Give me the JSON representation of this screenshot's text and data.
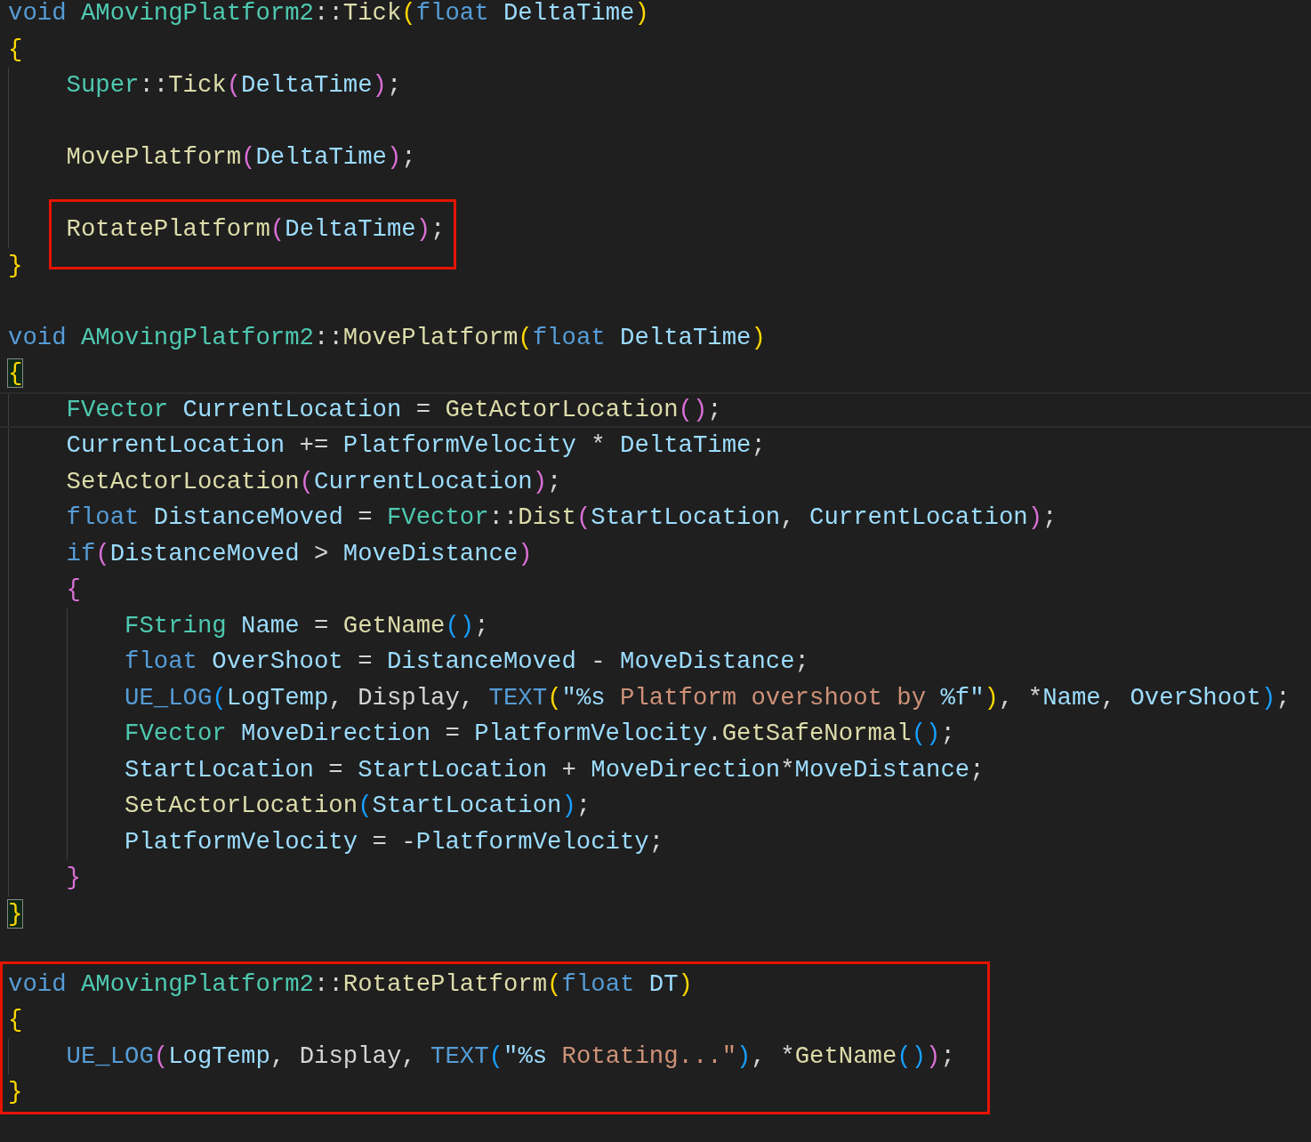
{
  "editor": {
    "lines": [
      {
        "kind": "code",
        "tokens": [
          {
            "text": "void ",
            "kind": "kw"
          },
          {
            "text": "AMovingPlatform2",
            "kind": "type"
          },
          {
            "text": "::",
            "kind": "op"
          },
          {
            "text": "Tick",
            "kind": "fn"
          },
          {
            "text": "(",
            "kind": "b1"
          },
          {
            "text": "float ",
            "kind": "kw"
          },
          {
            "text": "DeltaTime",
            "kind": "var"
          },
          {
            "text": ")",
            "kind": "b1"
          }
        ]
      },
      {
        "kind": "code",
        "tokens": [
          {
            "text": "{",
            "kind": "b1"
          }
        ]
      },
      {
        "kind": "code",
        "tokens": [
          {
            "text": "    Super",
            "kind": "type"
          },
          {
            "text": "::",
            "kind": "op"
          },
          {
            "text": "Tick",
            "kind": "fn"
          },
          {
            "text": "(",
            "kind": "b2"
          },
          {
            "text": "DeltaTime",
            "kind": "var"
          },
          {
            "text": ")",
            "kind": "b2"
          },
          {
            "text": ";",
            "kind": "op"
          }
        ]
      },
      {
        "kind": "blank"
      },
      {
        "kind": "code",
        "tokens": [
          {
            "text": "    MovePlatform",
            "kind": "fn"
          },
          {
            "text": "(",
            "kind": "b2"
          },
          {
            "text": "DeltaTime",
            "kind": "var"
          },
          {
            "text": ")",
            "kind": "b2"
          },
          {
            "text": ";",
            "kind": "op"
          }
        ]
      },
      {
        "kind": "blank"
      },
      {
        "kind": "code",
        "boxed": true,
        "tokens": [
          {
            "text": "    RotatePlatform",
            "kind": "fn"
          },
          {
            "text": "(",
            "kind": "b2"
          },
          {
            "text": "DeltaTime",
            "kind": "var"
          },
          {
            "text": ")",
            "kind": "b2"
          },
          {
            "text": ";",
            "kind": "op"
          }
        ]
      },
      {
        "kind": "code",
        "tokens": [
          {
            "text": "}",
            "kind": "b1"
          }
        ]
      },
      {
        "kind": "blank"
      },
      {
        "kind": "code",
        "tokens": [
          {
            "text": "void ",
            "kind": "kw"
          },
          {
            "text": "AMovingPlatform2",
            "kind": "type"
          },
          {
            "text": "::",
            "kind": "op"
          },
          {
            "text": "MovePlatform",
            "kind": "fn"
          },
          {
            "text": "(",
            "kind": "b1"
          },
          {
            "text": "float ",
            "kind": "kw"
          },
          {
            "text": "DeltaTime",
            "kind": "var"
          },
          {
            "text": ")",
            "kind": "b1"
          }
        ]
      },
      {
        "kind": "code",
        "tokens": [
          {
            "text": "{",
            "kind": "b1",
            "matched": true
          }
        ]
      },
      {
        "kind": "code",
        "current": true,
        "tokens": [
          {
            "text": "    FVector ",
            "kind": "type"
          },
          {
            "text": "CurrentLocation",
            "kind": "var"
          },
          {
            "text": " = ",
            "kind": "op"
          },
          {
            "text": "GetActorLocation",
            "kind": "fn"
          },
          {
            "text": "()",
            "kind": "b2"
          },
          {
            "text": ";",
            "kind": "op"
          }
        ]
      },
      {
        "kind": "code",
        "tokens": [
          {
            "text": "    CurrentLocation",
            "kind": "var"
          },
          {
            "text": " += ",
            "kind": "op"
          },
          {
            "text": "PlatformVelocity",
            "kind": "var"
          },
          {
            "text": " * ",
            "kind": "op"
          },
          {
            "text": "DeltaTime",
            "kind": "var"
          },
          {
            "text": ";",
            "kind": "op"
          }
        ]
      },
      {
        "kind": "code",
        "tokens": [
          {
            "text": "    SetActorLocation",
            "kind": "fn"
          },
          {
            "text": "(",
            "kind": "b2"
          },
          {
            "text": "CurrentLocation",
            "kind": "var"
          },
          {
            "text": ")",
            "kind": "b2"
          },
          {
            "text": ";",
            "kind": "op"
          }
        ]
      },
      {
        "kind": "code",
        "tokens": [
          {
            "text": "    float ",
            "kind": "kw"
          },
          {
            "text": "DistanceMoved",
            "kind": "var"
          },
          {
            "text": " = ",
            "kind": "op"
          },
          {
            "text": "FVector",
            "kind": "type"
          },
          {
            "text": "::",
            "kind": "op"
          },
          {
            "text": "Dist",
            "kind": "fn"
          },
          {
            "text": "(",
            "kind": "b2"
          },
          {
            "text": "StartLocation",
            "kind": "var"
          },
          {
            "text": ", ",
            "kind": "op"
          },
          {
            "text": "CurrentLocation",
            "kind": "var"
          },
          {
            "text": ")",
            "kind": "b2"
          },
          {
            "text": ";",
            "kind": "op"
          }
        ]
      },
      {
        "kind": "code",
        "tokens": [
          {
            "text": "    if",
            "kind": "kw"
          },
          {
            "text": "(",
            "kind": "b2"
          },
          {
            "text": "DistanceMoved",
            "kind": "var"
          },
          {
            "text": " > ",
            "kind": "op"
          },
          {
            "text": "MoveDistance",
            "kind": "var"
          },
          {
            "text": ")",
            "kind": "b2"
          }
        ]
      },
      {
        "kind": "code",
        "tokens": [
          {
            "text": "    {",
            "kind": "b2"
          }
        ]
      },
      {
        "kind": "code",
        "tokens": [
          {
            "text": "        FString ",
            "kind": "type"
          },
          {
            "text": "Name",
            "kind": "var"
          },
          {
            "text": " = ",
            "kind": "op"
          },
          {
            "text": "GetName",
            "kind": "fn"
          },
          {
            "text": "()",
            "kind": "b3"
          },
          {
            "text": ";",
            "kind": "op"
          }
        ]
      },
      {
        "kind": "code",
        "tokens": [
          {
            "text": "        float ",
            "kind": "kw"
          },
          {
            "text": "OverShoot",
            "kind": "var"
          },
          {
            "text": " = ",
            "kind": "op"
          },
          {
            "text": "DistanceMoved",
            "kind": "var"
          },
          {
            "text": " - ",
            "kind": "op"
          },
          {
            "text": "MoveDistance",
            "kind": "var"
          },
          {
            "text": ";",
            "kind": "op"
          }
        ]
      },
      {
        "kind": "code",
        "tokens": [
          {
            "text": "        UE_LOG",
            "kind": "kw"
          },
          {
            "text": "(",
            "kind": "b3"
          },
          {
            "text": "LogTemp",
            "kind": "var"
          },
          {
            "text": ", Display, ",
            "kind": "op"
          },
          {
            "text": "TEXT",
            "kind": "kw"
          },
          {
            "text": "(",
            "kind": "b1"
          },
          {
            "text": "\"%s",
            "kind": "fmt"
          },
          {
            "text": " Platform overshoot by ",
            "kind": "str"
          },
          {
            "text": "%f\"",
            "kind": "fmt"
          },
          {
            "text": ")",
            "kind": "b1"
          },
          {
            "text": ", *",
            "kind": "op"
          },
          {
            "text": "Name",
            "kind": "var"
          },
          {
            "text": ", ",
            "kind": "op"
          },
          {
            "text": "OverShoot",
            "kind": "var"
          },
          {
            "text": ")",
            "kind": "b3"
          },
          {
            "text": ";",
            "kind": "op"
          }
        ]
      },
      {
        "kind": "code",
        "tokens": [
          {
            "text": "        FVector ",
            "kind": "type"
          },
          {
            "text": "MoveDirection",
            "kind": "var"
          },
          {
            "text": " = ",
            "kind": "op"
          },
          {
            "text": "PlatformVelocity",
            "kind": "var"
          },
          {
            "text": ".",
            "kind": "op"
          },
          {
            "text": "GetSafeNormal",
            "kind": "fn"
          },
          {
            "text": "()",
            "kind": "b3"
          },
          {
            "text": ";",
            "kind": "op"
          }
        ]
      },
      {
        "kind": "code",
        "tokens": [
          {
            "text": "        StartLocation",
            "kind": "var"
          },
          {
            "text": " = ",
            "kind": "op"
          },
          {
            "text": "StartLocation",
            "kind": "var"
          },
          {
            "text": " + ",
            "kind": "op"
          },
          {
            "text": "MoveDirection",
            "kind": "var"
          },
          {
            "text": "*",
            "kind": "op"
          },
          {
            "text": "MoveDistance",
            "kind": "var"
          },
          {
            "text": ";",
            "kind": "op"
          }
        ]
      },
      {
        "kind": "code",
        "tokens": [
          {
            "text": "        SetActorLocation",
            "kind": "fn"
          },
          {
            "text": "(",
            "kind": "b3"
          },
          {
            "text": "StartLocation",
            "kind": "var"
          },
          {
            "text": ")",
            "kind": "b3"
          },
          {
            "text": ";",
            "kind": "op"
          }
        ]
      },
      {
        "kind": "code",
        "tokens": [
          {
            "text": "        PlatformVelocity",
            "kind": "var"
          },
          {
            "text": " = -",
            "kind": "op"
          },
          {
            "text": "PlatformVelocity",
            "kind": "var"
          },
          {
            "text": ";",
            "kind": "op"
          }
        ]
      },
      {
        "kind": "code",
        "tokens": [
          {
            "text": "    }",
            "kind": "b2"
          }
        ]
      },
      {
        "kind": "code",
        "tokens": [
          {
            "text": "}",
            "kind": "b1",
            "matched": true
          }
        ]
      },
      {
        "kind": "blank"
      },
      {
        "kind": "code",
        "boxed": true,
        "tokens": [
          {
            "text": "void ",
            "kind": "kw"
          },
          {
            "text": "AMovingPlatform2",
            "kind": "type"
          },
          {
            "text": "::",
            "kind": "op"
          },
          {
            "text": "RotatePlatform",
            "kind": "fn"
          },
          {
            "text": "(",
            "kind": "b1"
          },
          {
            "text": "float ",
            "kind": "kw"
          },
          {
            "text": "DT",
            "kind": "var"
          },
          {
            "text": ")",
            "kind": "b1"
          }
        ]
      },
      {
        "kind": "code",
        "boxed": true,
        "tokens": [
          {
            "text": "{",
            "kind": "b1"
          }
        ]
      },
      {
        "kind": "code",
        "boxed": true,
        "tokens": [
          {
            "text": "    UE_LOG",
            "kind": "kw"
          },
          {
            "text": "(",
            "kind": "b2"
          },
          {
            "text": "LogTemp",
            "kind": "var"
          },
          {
            "text": ", Display, ",
            "kind": "op"
          },
          {
            "text": "TEXT",
            "kind": "kw"
          },
          {
            "text": "(",
            "kind": "b3"
          },
          {
            "text": "\"%s",
            "kind": "fmt"
          },
          {
            "text": " Rotating...\"",
            "kind": "str"
          },
          {
            "text": ")",
            "kind": "b3"
          },
          {
            "text": ", *",
            "kind": "op"
          },
          {
            "text": "GetName",
            "kind": "fn"
          },
          {
            "text": "()",
            "kind": "b3"
          },
          {
            "text": ")",
            "kind": "b2"
          },
          {
            "text": ";",
            "kind": "op"
          }
        ]
      },
      {
        "kind": "code",
        "boxed": true,
        "tokens": [
          {
            "text": "}",
            "kind": "b1"
          }
        ]
      }
    ]
  }
}
